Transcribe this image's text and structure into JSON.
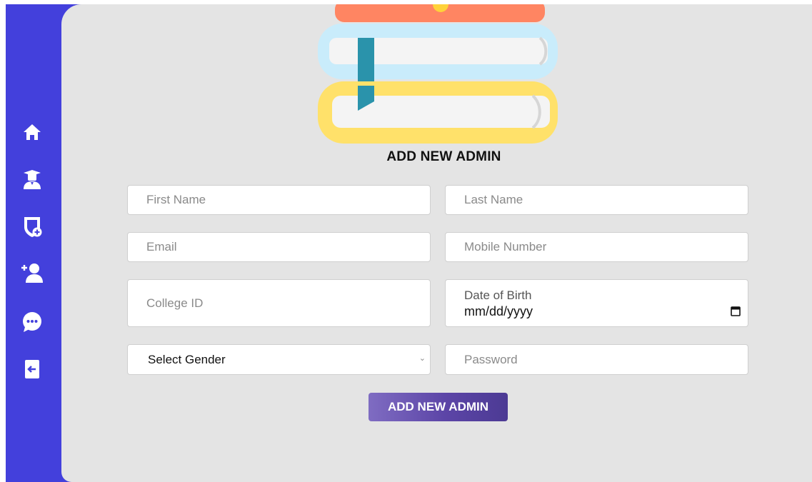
{
  "sidebar": {
    "items": [
      {
        "icon": "home-icon"
      },
      {
        "icon": "graduate-icon"
      },
      {
        "icon": "add-shield-icon"
      },
      {
        "icon": "add-user-icon"
      },
      {
        "icon": "chat-icon"
      },
      {
        "icon": "logout-icon"
      }
    ]
  },
  "form": {
    "title": "ADD NEW ADMIN",
    "first_name_placeholder": "First Name",
    "last_name_placeholder": "Last Name",
    "email_placeholder": "Email",
    "mobile_placeholder": "Mobile Number",
    "college_id_placeholder": "College ID",
    "dob_label": "Date of Birth",
    "dob_value": "mm/dd/yyyy",
    "gender_selected": "Select Gender",
    "password_placeholder": "Password",
    "submit_label": "ADD NEW ADMIN"
  },
  "colors": {
    "sidebar": "#4340dc",
    "background": "#e4e4e4",
    "button_start": "#7f6cc2",
    "button_end": "#4c3a94"
  }
}
